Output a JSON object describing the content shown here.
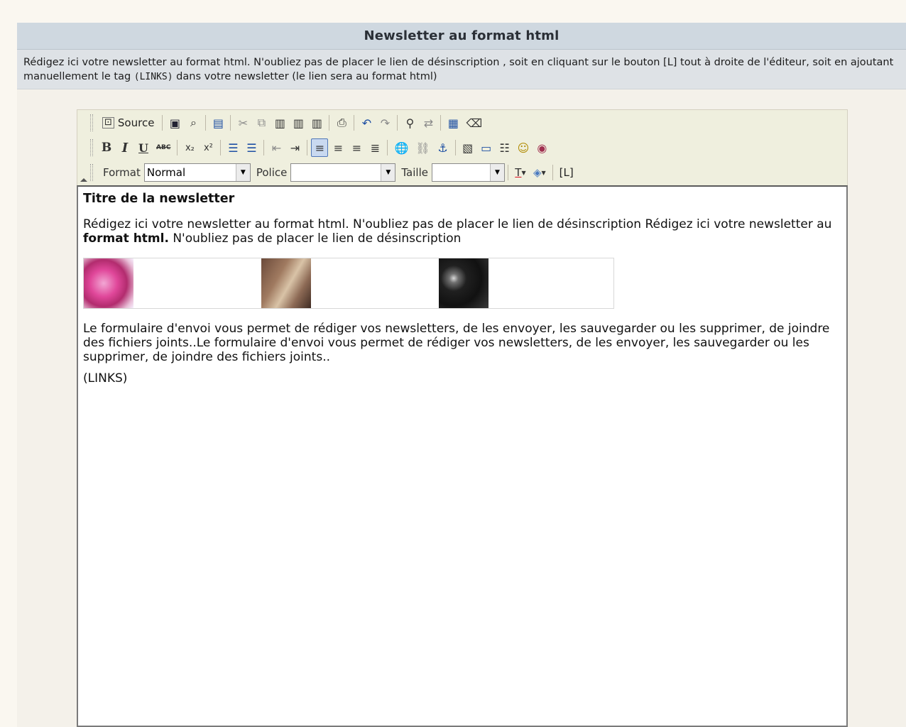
{
  "panel": {
    "header": "Newsletter au format html",
    "desc_part1": "Rédigez ici votre newsletter au format html. N'oubliez pas de placer le lien de désinscription , soit en cliquant sur le bouton [L] tout à droite de l'éditeur, soit en ajoutant manuellement le tag ",
    "desc_tag": "(LINKS)",
    "desc_part2": " dans votre newsletter (le lien sera au format html)"
  },
  "toolbar": {
    "row1": [
      {
        "name": "source-button",
        "label": "Source",
        "icon": "source-icon"
      },
      {
        "name": "save-icon",
        "glyph": "💾"
      },
      {
        "name": "preview-icon",
        "glyph": "🔍"
      },
      {
        "name": "templates-icon",
        "glyph": "📄"
      },
      {
        "name": "cut-icon",
        "glyph": "✂"
      },
      {
        "name": "copy-icon",
        "glyph": "⎘"
      },
      {
        "name": "paste-icon",
        "glyph": "📋"
      },
      {
        "name": "paste-text-icon",
        "glyph": "📋"
      },
      {
        "name": "paste-word-icon",
        "glyph": "📋"
      },
      {
        "name": "print-icon",
        "glyph": "🖶"
      },
      {
        "name": "undo-icon",
        "glyph": "↶"
      },
      {
        "name": "redo-icon",
        "glyph": "↷"
      },
      {
        "name": "find-icon",
        "glyph": "🔭"
      },
      {
        "name": "replace-icon",
        "glyph": "⇄"
      },
      {
        "name": "select-all-icon",
        "glyph": "▦"
      },
      {
        "name": "remove-format-icon",
        "glyph": "⌫"
      }
    ],
    "format_label": "Format",
    "format_value": "Normal",
    "font_label": "Police",
    "font_value": "",
    "size_label": "Taille",
    "size_value": "",
    "links_button": "[L]",
    "text_color_glyph": "T",
    "bg_color_glyph": "◈"
  },
  "content": {
    "title": "Titre de la newsletter",
    "para1_a": "Rédigez ici votre newsletter au format html. N'oubliez pas de placer le lien de désinscription Rédigez ici votre newsletter au ",
    "para1_bold": "format html.",
    "para1_b": " N'oubliez pas de placer le lien de désinscription",
    "para2": "Le formulaire d'envoi vous permet de rédiger vos newsletters, de les envoyer, les sauvegarder ou les supprimer, de joindre des fichiers joints..Le formulaire d'envoi vous permet de rédiger vos newsletters, de les envoyer, les sauvegarder ou les supprimer, de joindre des fichiers joints..",
    "links_tag": "(LINKS)"
  },
  "colors": {
    "header_bg": "#cfd8e0",
    "desc_bg": "#dee2e6",
    "toolbar_bg": "#efefde",
    "active_button": "#c9d9f0"
  }
}
